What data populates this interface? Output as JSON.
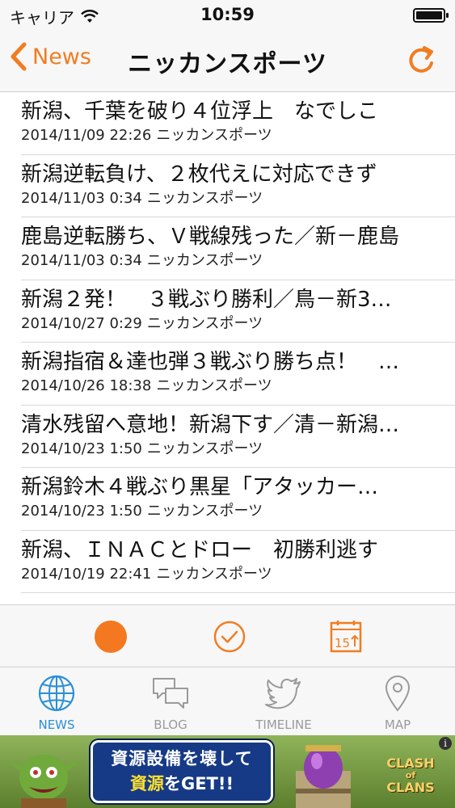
{
  "status_bar": {
    "carrier": "キャリア",
    "time": "10:59"
  },
  "nav": {
    "back_label": "News",
    "title": "ニッカンスポーツ"
  },
  "articles": [
    {
      "title": "新潟、千葉を破り４位浮上　なでしこ",
      "date": "2014/11/09 22:26",
      "source": "ニッカンスポーツ"
    },
    {
      "title": "新潟逆転負け、２枚代えに対応できず",
      "date": "2014/11/03 0:34",
      "source": "ニッカンスポーツ"
    },
    {
      "title": "鹿島逆転勝ち、Ｖ戦線残った／新－鹿島",
      "date": "2014/11/03 0:34",
      "source": "ニッカンスポーツ"
    },
    {
      "title": "新潟２発！　３戦ぶり勝利／鳥－新3…",
      "date": "2014/10/27 0:29",
      "source": "ニッカンスポーツ"
    },
    {
      "title": "新潟指宿＆達也弾３戦ぶり勝ち点！　…",
      "date": "2014/10/26 18:38",
      "source": "ニッカンスポーツ"
    },
    {
      "title": "清水残留へ意地！新潟下す／清－新潟…",
      "date": "2014/10/23 1:50",
      "source": "ニッカンスポーツ"
    },
    {
      "title": "新潟鈴木４戦ぶり黒星「アタッカー…",
      "date": "2014/10/23 1:50",
      "source": "ニッカンスポーツ"
    },
    {
      "title": "新潟、ＩＮＡＣとドロー　初勝利逃す",
      "date": "2014/10/19 22:41",
      "source": "ニッカンスポーツ"
    }
  ],
  "toolbar": {
    "calendar_number": "15"
  },
  "tabs": [
    {
      "label": "NEWS"
    },
    {
      "label": "BLOG"
    },
    {
      "label": "TIMELINE"
    },
    {
      "label": "MAP"
    }
  ],
  "ad": {
    "line1": "資源設備を壊して",
    "line2_highlight": "資源",
    "line2_rest": "をGET!!",
    "logo_top": "CLASH",
    "logo_of": "of",
    "logo_bottom": "CLANS",
    "info": "i"
  },
  "colors": {
    "accent": "#f07d22",
    "tab_active": "#2a8fd6",
    "tab_inactive": "#9a9a9a"
  }
}
